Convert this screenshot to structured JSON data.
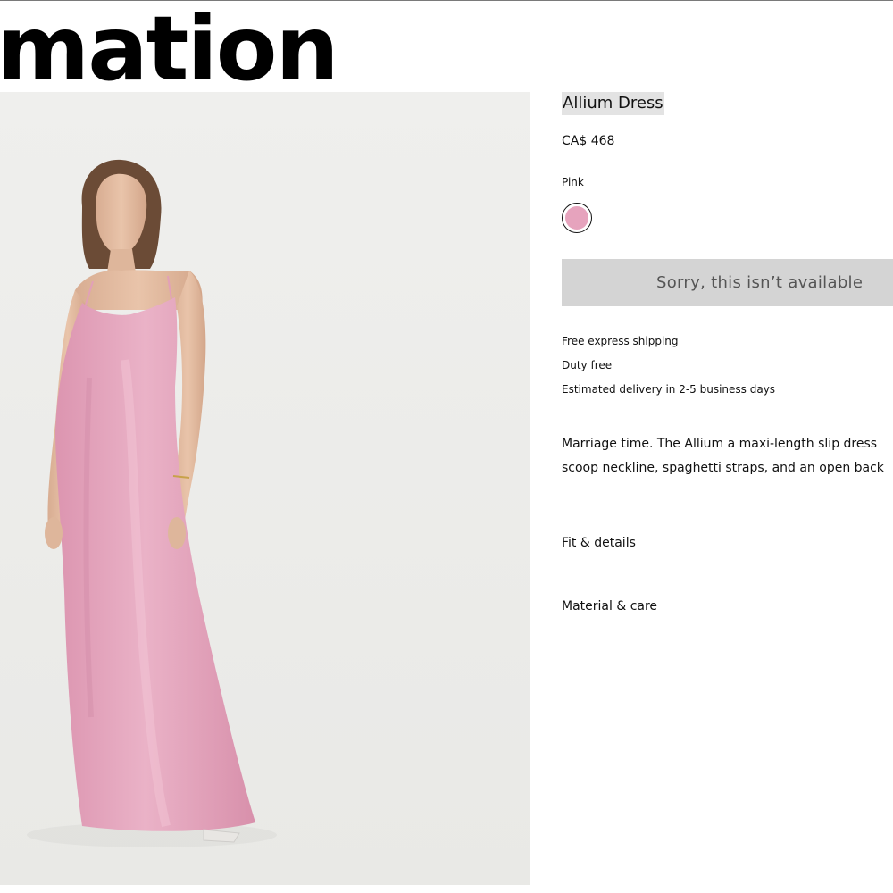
{
  "brand": {
    "visible_text": "mation"
  },
  "product": {
    "title": "Allium Dress",
    "price": "CA$ 468",
    "color_label": "Pink",
    "swatch_color": "#e6a3bd",
    "availability_button": "Sorry, this isn’t available",
    "perks": [
      "Free express shipping",
      "Duty free",
      "Estimated delivery in 2-5 business days"
    ],
    "description_lines": [
      "Marriage time. The Allium a maxi-length slip dress",
      "scoop neckline, spaghetti straps, and an open back"
    ],
    "accordions": [
      "Fit & details",
      "Material & care"
    ]
  },
  "colors": {
    "image_background": "#eeeeec",
    "dress_pink": "#e8a9c1",
    "button_background": "#d4d4d4",
    "button_text": "#555555",
    "title_highlight": "#e3e3e3"
  }
}
